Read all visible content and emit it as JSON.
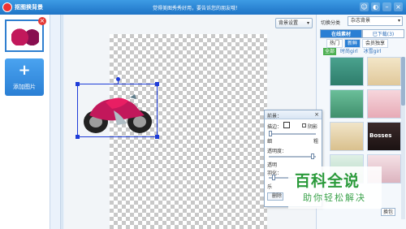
{
  "app": {
    "title": "抠图换背景",
    "promo": "觉得美图秀秀好用，要告诉您的朋友哦！"
  },
  "left": {
    "add_label": "添加图片",
    "add_icon": "plus-icon"
  },
  "canvas": {
    "bg_settings_label": "背景设置"
  },
  "right": {
    "category_label": "切换分类",
    "category_value": "杂志背景",
    "tabs": [
      {
        "label": "在线素材"
      },
      {
        "label": "已下载(3)"
      }
    ],
    "subtabs": [
      {
        "label": "热门"
      },
      {
        "label": "新鲜"
      },
      {
        "label": "会员独享"
      }
    ],
    "filters": [
      {
        "label": "全部"
      },
      {
        "label": "时尚girl"
      },
      {
        "label": "冰雪girl"
      }
    ],
    "tile_text": "Bosses",
    "bottom_btn": "换包"
  },
  "front_panel": {
    "title": "前景：",
    "stroke_label": "描边：",
    "shadow_label": "阴影",
    "thin_label": "细",
    "thick_label": "粗",
    "opacity_label": "透明度：",
    "edge_label": "透明",
    "feather_label": "羽化：",
    "le_label": "乐",
    "delete_label": "删除"
  },
  "watermark": {
    "big": "百科全说",
    "small": "助你轻松解决"
  },
  "colors": {
    "accent": "#2a7fd4",
    "titlebar": "#1f74c6",
    "selection": "#1e3cd8",
    "watermark": "#2a9a3a"
  }
}
